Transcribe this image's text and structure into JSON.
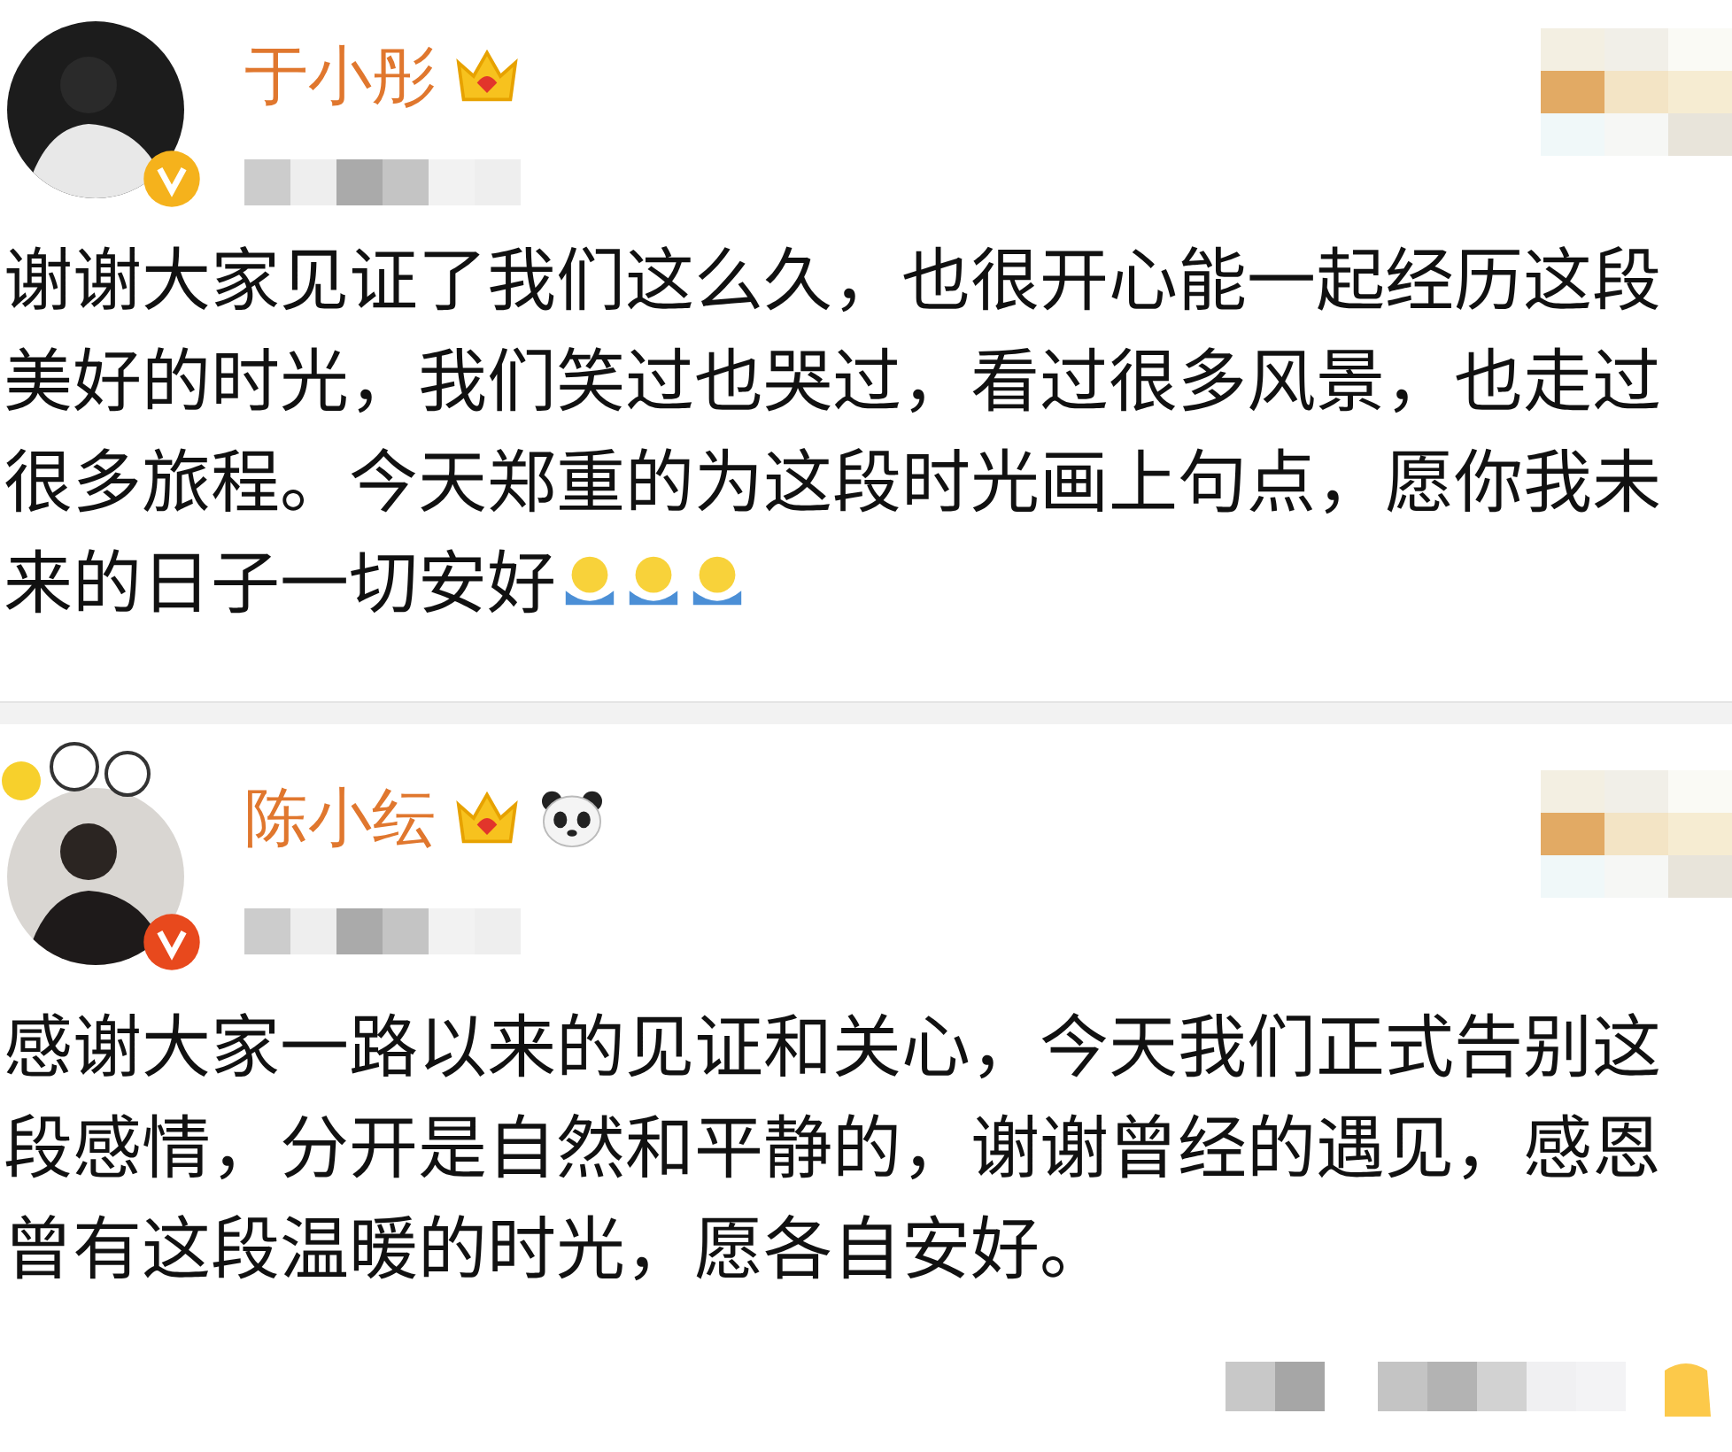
{
  "posts": [
    {
      "author": "于小彤",
      "badge": {
        "color": "#f5b21c"
      },
      "lines": [
        "谢谢大家见证了我们这么久，也很开心能一起经历这段",
        "美好的时光，我们笑过也哭过，看过很多风景，也走过",
        "很多旅程。今天郑重的为这段时光画上句点，愿你我未",
        "来的日子一切安好"
      ]
    },
    {
      "author": "陈小纭",
      "badge": {
        "color": "#e8491d"
      },
      "lines": [
        "感谢大家一路以来的见证和关心，今天我们正式告别这",
        "段感情，分开是自然和平静的，谢谢曾经的遇见，感恩",
        "曾有这段温暖的时光，愿各自安好。"
      ]
    }
  ]
}
